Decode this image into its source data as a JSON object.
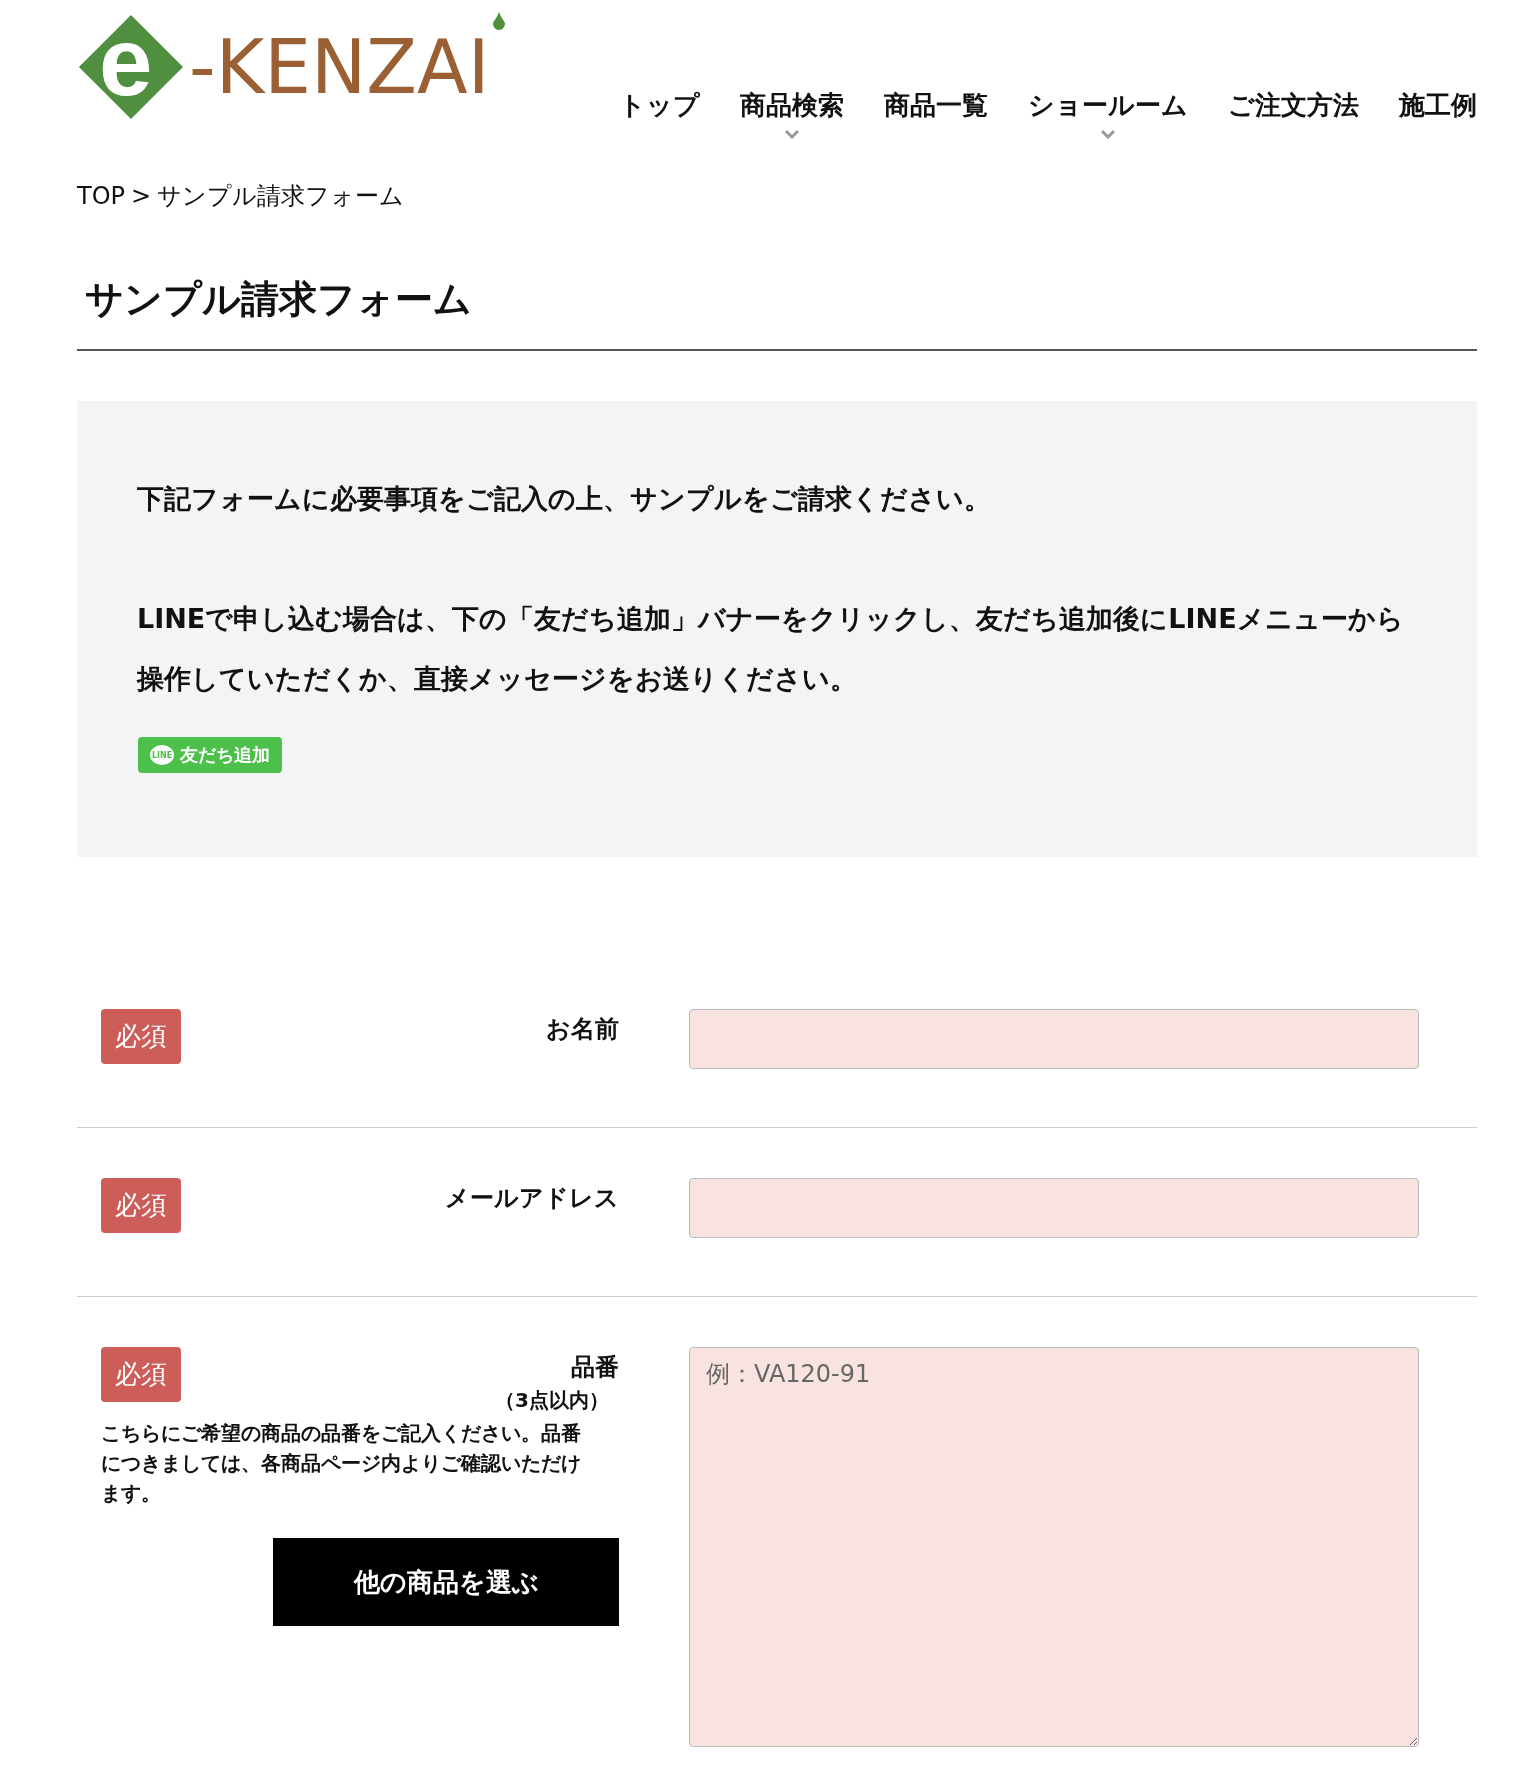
{
  "logo": {
    "mark": "e",
    "text": "-KENZAI"
  },
  "nav": [
    {
      "label": "トップ",
      "has_submenu": false
    },
    {
      "label": "商品検索",
      "has_submenu": true
    },
    {
      "label": "商品一覧",
      "has_submenu": false
    },
    {
      "label": "ショールーム",
      "has_submenu": true
    },
    {
      "label": "ご注文方法",
      "has_submenu": false
    },
    {
      "label": "施工例",
      "has_submenu": false
    }
  ],
  "breadcrumb": {
    "home": "TOP",
    "separator": ">",
    "current": "サンプル請求フォーム"
  },
  "page_title": "サンプル請求フォーム",
  "notice": {
    "paragraphs": [
      "下記フォームに必要事項をご記入の上、サンプルをご請求ください。",
      "LINEで申し込む場合は、下の「友だち追加」バナーをクリックし、友だち追加後にLINEメニューから操作していただくか、直接メッセージをお送りください。"
    ],
    "line_button": {
      "icon_text": "LINE",
      "label": "友だち追加"
    }
  },
  "form_rows": [
    {
      "kind": "input",
      "required": true,
      "badge": "必須",
      "label": "お名前"
    },
    {
      "kind": "input",
      "required": true,
      "badge": "必須",
      "label": "メールアドレス"
    },
    {
      "kind": "textarea",
      "required": true,
      "badge": "必須",
      "label": "品番",
      "sublabel": "（3点以内）",
      "help": "こちらにご希望の商品の品番をご記入ください。品番につきましては、各商品ページ内よりご確認いただけます。",
      "placeholder": "例：VA120-91",
      "button": "他の商品を選ぶ"
    }
  ]
}
